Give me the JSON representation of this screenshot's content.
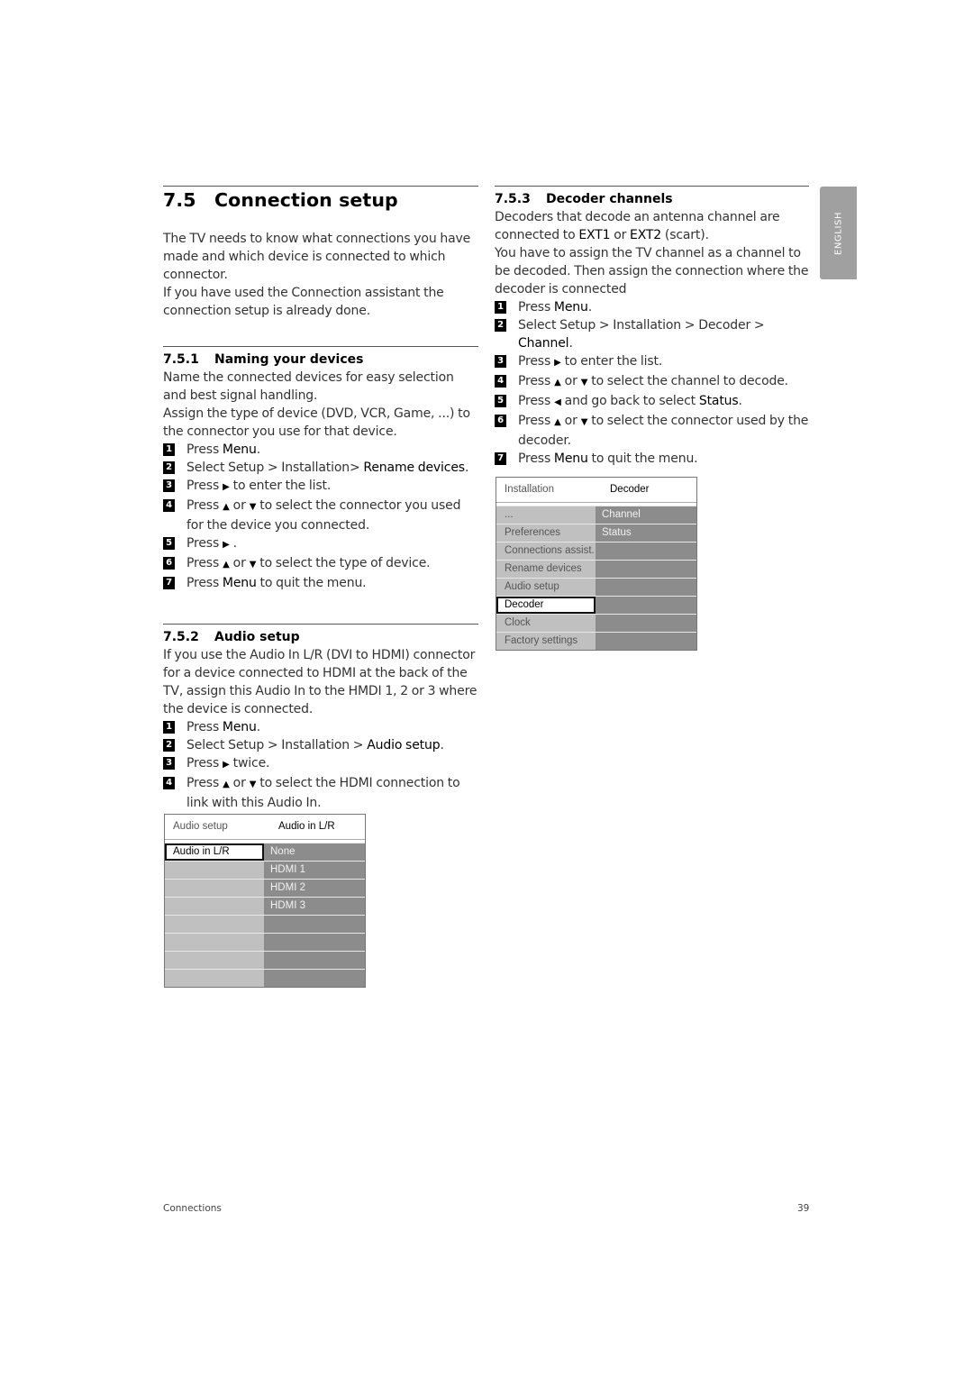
{
  "section": {
    "number": "7.5",
    "title": "Connection setup",
    "intro": [
      "The TV needs to know what connections you have made and which device is connected to which connector.",
      "If you have used the Connection assistant the connection setup is already done."
    ]
  },
  "naming": {
    "number": "7.5.1",
    "title": "Naming your devices",
    "paras": [
      "Name the connected devices for easy selection and best signal handling.",
      "Assign the type of device (DVD, VCR, Game, ...) to the connector you use for that device."
    ],
    "steps": [
      {
        "n": "1",
        "pre": "Press ",
        "bold": "Menu",
        "post": "."
      },
      {
        "n": "2",
        "pre": "Select Setup > Installation> ",
        "bold": "Rename devices",
        "post": "."
      },
      {
        "n": "3",
        "pre": "Press",
        "arrow": "▶",
        "post": "to enter the list."
      },
      {
        "n": "4",
        "pre": "Press",
        "arrow": "▲",
        "mid": "or",
        "arrow2": "▼",
        "post": "to select the connector you used for the device you connected."
      },
      {
        "n": "5",
        "pre": "Press",
        "arrow": "▶",
        "post": "."
      },
      {
        "n": "6",
        "pre": "Press",
        "arrow": "▲",
        "mid": "or",
        "arrow2": "▼",
        "post": "to select the type of device."
      },
      {
        "n": "7",
        "pre": "Press ",
        "bold": "Menu",
        "post": " to quit the menu."
      }
    ]
  },
  "audio": {
    "number": "7.5.2",
    "title": "Audio setup",
    "para": "If you use the Audio In L/R (DVI to HDMI) connector for a device connected to HDMI at the back of the TV, assign this Audio In to the HMDI 1, 2 or 3 where the device is connected.",
    "steps": [
      {
        "n": "1",
        "pre": "Press ",
        "bold": "Menu",
        "post": "."
      },
      {
        "n": "2",
        "pre": "Select Setup > Installation > ",
        "bold": "Audio setup",
        "post": "."
      },
      {
        "n": "3",
        "pre": "Press",
        "arrow": "▶",
        "post": "twice."
      },
      {
        "n": "4",
        "pre": "Press",
        "arrow": "▲",
        "mid": "or",
        "arrow2": "▼",
        "post": "to select the HDMI connection to link with this Audio In."
      }
    ],
    "menu": {
      "header_left": "Audio setup",
      "header_right": "Audio in L/R",
      "left_items": [
        "Audio in L/R",
        "",
        "",
        "",
        "",
        "",
        "",
        ""
      ],
      "right_items": [
        "None",
        "HDMI 1",
        "HDMI 2",
        "HDMI 3",
        "",
        "",
        "",
        ""
      ],
      "selected_index": 0
    }
  },
  "decoder": {
    "number": "7.5.3",
    "title": "Decoder channels",
    "para1_pre": "Decoders that decode an antenna channel are connected to ",
    "ext1": "EXT1",
    "para1_mid": " or ",
    "ext2": "EXT2",
    "para1_post": " (scart).",
    "para2": "You have to assign the TV channel as a channel to be decoded. Then assign the connection where the decoder is connected",
    "steps": [
      {
        "n": "1",
        "pre": "Press ",
        "bold": "Menu",
        "post": "."
      },
      {
        "n": "2",
        "pre": "Select Setup > Installation > Decoder > ",
        "bold": "Channel",
        "post": "."
      },
      {
        "n": "3",
        "pre": "Press",
        "arrow": "▶",
        "post": "to enter the list."
      },
      {
        "n": "4",
        "pre": "Press",
        "arrow": "▲",
        "mid": "or",
        "arrow2": "▼",
        "post": "to select the channel to decode."
      },
      {
        "n": "5",
        "pre": "Press",
        "arrow": "◀",
        "post": "and go back to select ",
        "bold_end": "Status",
        "post2": "."
      },
      {
        "n": "6",
        "pre": "Press",
        "arrow": "▲",
        "mid": "or",
        "arrow2": "▼",
        "post": "to select the connector used by the decoder."
      },
      {
        "n": "7",
        "pre": "Press ",
        "bold": "Menu",
        "post": " to quit the menu."
      }
    ],
    "menu": {
      "header_left": "Installation",
      "header_right": "Decoder",
      "left_items": [
        "...",
        "Preferences",
        "Connections assist.",
        "Rename devices",
        "Audio setup",
        "Decoder",
        "Clock",
        "Factory settings"
      ],
      "right_items": [
        "Channel",
        "Status",
        "",
        "",
        "",
        "",
        "",
        ""
      ],
      "selected_index": 5
    }
  },
  "language_tab": "ENGLISH",
  "footer": {
    "chapter": "Connections",
    "page": "39"
  }
}
